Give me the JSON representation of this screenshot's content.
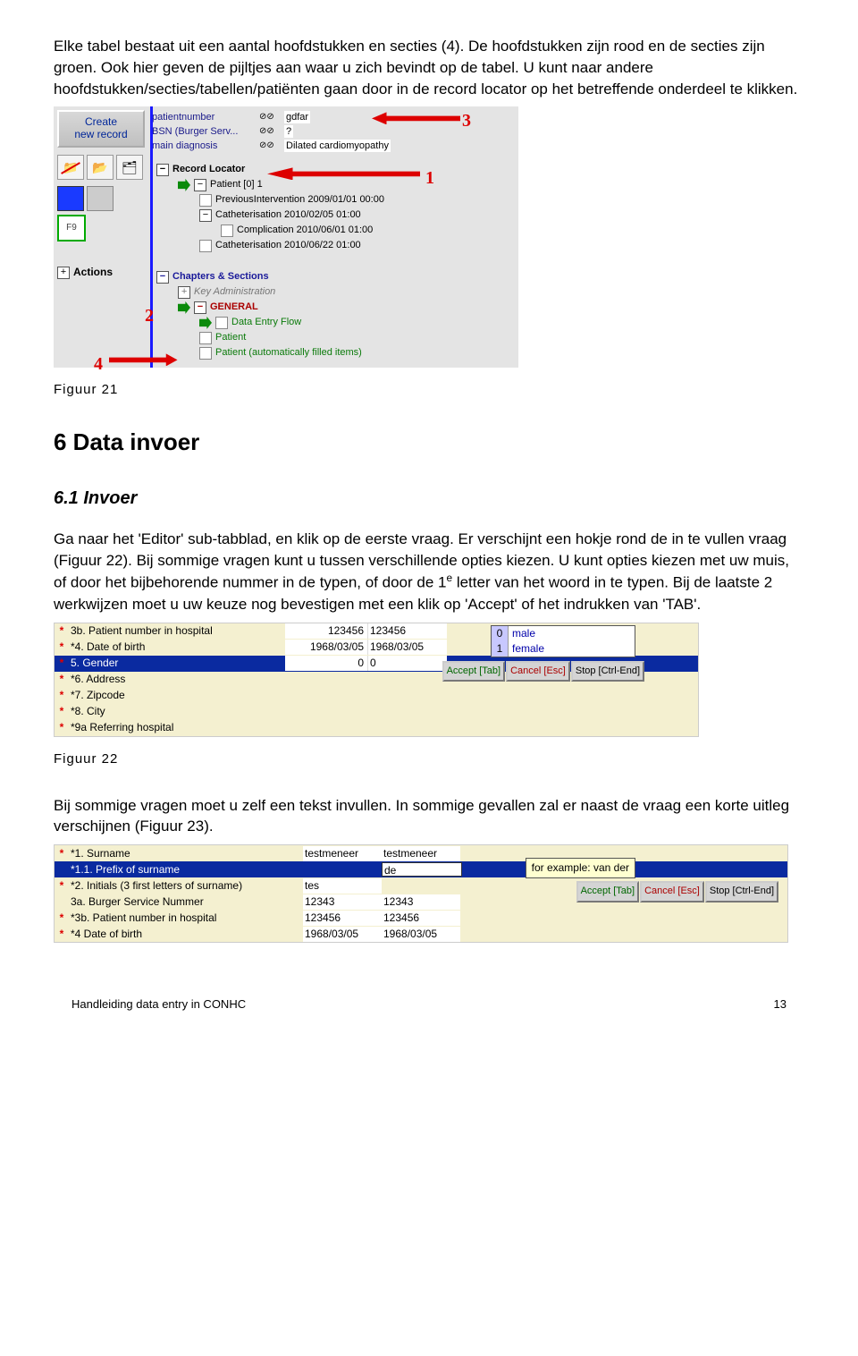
{
  "para1": "Elke tabel bestaat uit een aantal hoofdstukken en secties (4). De hoofdstukken zijn rood en de secties zijn groen. Ook hier geven de pijltjes aan waar u zich bevindt op de tabel. U kunt naar andere hoofdstukken/secties/tabellen/patiënten gaan door in de record locator op het betreffende onderdeel te klikken.",
  "fig21": {
    "caption": "Figuur 21",
    "create_btn_line1": "Create",
    "create_btn_line2": "new record",
    "top": [
      {
        "label": "patientnumber",
        "qc": "⊘⊘",
        "val": "gdfar"
      },
      {
        "label": "BSN (Burger Serv...",
        "qc": "⊘⊘",
        "val": "?"
      },
      {
        "label": "main diagnosis",
        "qc": "⊘⊘",
        "val": "Dilated cardiomyopathy"
      }
    ],
    "f9": "F9",
    "actions": "Actions",
    "tree": {
      "record_locator": "Record Locator",
      "patient": "Patient [0] 1",
      "prev": "PreviousIntervention 2009/01/01 00:00",
      "cath1": "Catheterisation 2010/02/05 01:00",
      "comp": "Complication 2010/06/01 01:00",
      "cath2": "Catheterisation 2010/06/22 01:00",
      "chapters": "Chapters & Sections",
      "keyadmin": "Key Administration",
      "general": "GENERAL",
      "flow": "Data Entry Flow",
      "patient2": "Patient",
      "patient3": "Patient (automatically filled items)"
    },
    "nums": {
      "n1": "1",
      "n2": "2",
      "n3": "3",
      "n4": "4"
    }
  },
  "h2": "6 Data invoer",
  "h3": "6.1 Invoer",
  "para2_a": "Ga naar het 'Editor' sub-tabblad, en klik op de eerste vraag. Er verschijnt een hokje rond de in te vullen vraag (Figuur 22). Bij sommige vragen kunt u tussen verschillende opties kiezen. U kunt opties kiezen met uw muis, of door het bijbehorende nummer in de typen, of door de 1",
  "para2_sup": "e",
  "para2_b": " letter van het woord in te typen. Bij de laatste 2 werkwijzen moet u uw keuze nog bevestigen met een klik op 'Accept' of het indrukken van 'TAB'.",
  "fig22": {
    "caption": "Figuur 22",
    "rows": [
      {
        "mark": "*",
        "q": "3b. Patient number in hospital",
        "c1": "123456",
        "c2": "123456"
      },
      {
        "mark": "*",
        "q": "*4. Date of birth",
        "c1": "1968/03/05",
        "c2": "1968/03/05"
      },
      {
        "mark": "*",
        "q": "5. Gender",
        "c1": "0",
        "c2": "0",
        "sel": true
      },
      {
        "mark": "*",
        "q": "*6. Address",
        "c1": "",
        "c2": ""
      },
      {
        "mark": "*",
        "q": "*7. Zipcode",
        "c1": "",
        "c2": ""
      },
      {
        "mark": "*",
        "q": "*8. City",
        "c1": "",
        "c2": ""
      },
      {
        "mark": "*",
        "q": "*9a  Referring hospital",
        "c1": "",
        "c2": ""
      }
    ],
    "dropdown": [
      {
        "k": "0",
        "v": "male"
      },
      {
        "k": "1",
        "v": "female"
      }
    ],
    "btns": {
      "accept": "Accept [Tab]",
      "cancel": "Cancel [Esc]",
      "stop": "Stop [Ctrl-End]"
    }
  },
  "para3": "Bij sommige vragen moet u zelf een tekst invullen. In sommige gevallen zal er naast de vraag een korte uitleg verschijnen (Figuur 23).",
  "fig23": {
    "rows": [
      {
        "mark": "*",
        "q": "*1. Surname",
        "c1": "testmeneer",
        "c2": "testmeneer"
      },
      {
        "mark": "",
        "q": "*1.1. Prefix of surname",
        "c1": "",
        "c2": "de",
        "sel": true
      },
      {
        "mark": "*",
        "q": "*2. Initials (3 first letters of surname)",
        "c1": "tes",
        "c2": ""
      },
      {
        "mark": "",
        "q": "3a. Burger Service Nummer",
        "c1": "12343",
        "c2": "12343"
      },
      {
        "mark": "*",
        "q": "*3b. Patient number in hospital",
        "c1": "123456",
        "c2": "123456"
      },
      {
        "mark": "*",
        "q": "*4  Date of birth",
        "c1": "1968/03/05",
        "c2": "1968/03/05"
      }
    ],
    "tooltip": "for example: van der",
    "btns": {
      "accept": "Accept [Tab]",
      "cancel": "Cancel [Esc]",
      "stop": "Stop [Ctrl-End]"
    }
  },
  "footer": {
    "left": "Handleiding data entry in CONHC",
    "right": "13"
  }
}
